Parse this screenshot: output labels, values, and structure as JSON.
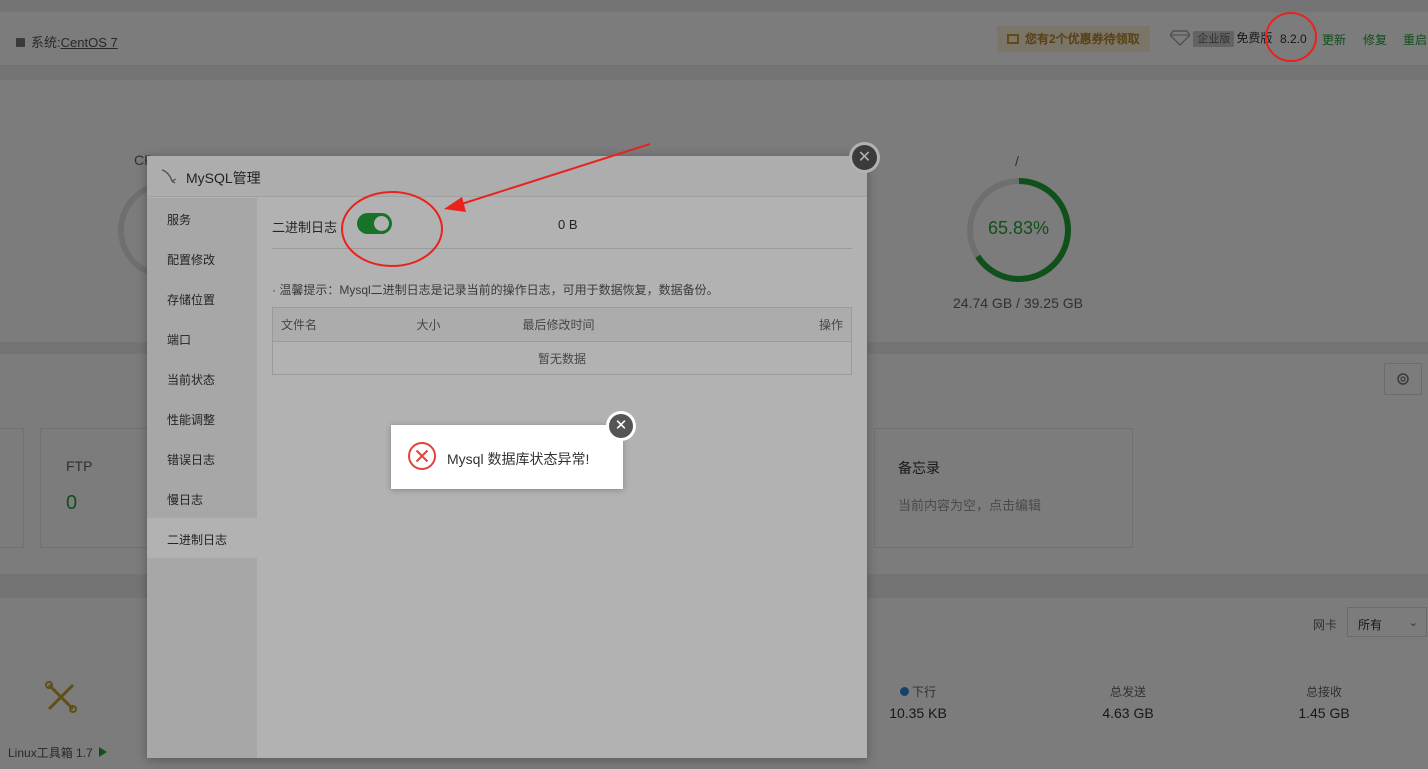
{
  "topbar": {
    "system_label": "系统:",
    "system_value": "CentOS 7",
    "coupon": "您有2个优惠券待领取",
    "edition_tag": "企业版",
    "edition_free": "免费版",
    "version": "8.2.0",
    "links": [
      "更新",
      "修复",
      "重启"
    ]
  },
  "dashboard": {
    "disk_path": "/",
    "disk_percent": "65.83%",
    "disk_percent_value": 65.83,
    "disk_usage": "24.74 GB / 39.25 GB",
    "ftp_label": "FTP",
    "ftp_count": "0",
    "memo_title": "备忘录",
    "memo_placeholder": "当前内容为空，点击编辑",
    "nic_label": "网卡",
    "nic_select": "所有",
    "down_label": "下行",
    "down_value": "10.35 KB",
    "sent_label": "总发送",
    "sent_value": "4.63 GB",
    "recv_label": "总接收",
    "recv_value": "1.45 GB",
    "linux_tools": "Linux工具箱 1.7"
  },
  "modal": {
    "title": "MySQL管理",
    "menu": [
      "服务",
      "配置修改",
      "存储位置",
      "端口",
      "当前状态",
      "性能调整",
      "错误日志",
      "慢日志",
      "二进制日志"
    ],
    "active_index": 8,
    "binlog_label": "二进制日志",
    "binlog_enabled": true,
    "binlog_size": "0 B",
    "tips": "· 温馨提示：Mysql二进制日志是记录当前的操作日志，可用于数据恢复，数据备份。",
    "table_headers": [
      "文件名",
      "大小",
      "最后修改时间",
      "操作"
    ],
    "empty_text": "暂无数据"
  },
  "toast": {
    "message": "Mysql 数据库状态异常!"
  },
  "colors": {
    "accent": "#20a53a",
    "error": "#e0443e",
    "annotation": "#e8231d"
  }
}
